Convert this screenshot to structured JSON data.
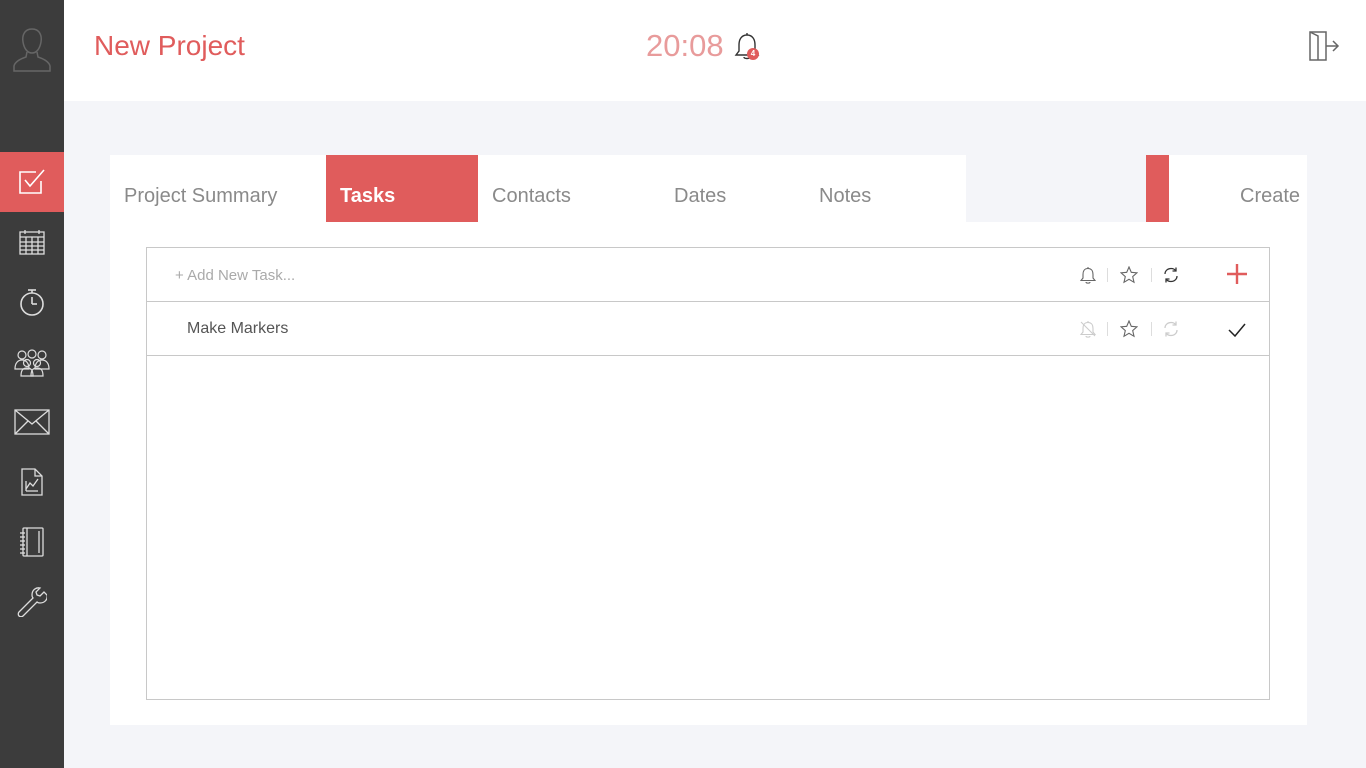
{
  "header": {
    "title": "New Project",
    "clock": "20:08",
    "notification_count": "4"
  },
  "sidebar": {
    "items": [
      {
        "icon": "checkbox-icon",
        "active": true
      },
      {
        "icon": "calendar-icon",
        "active": false
      },
      {
        "icon": "stopwatch-icon",
        "active": false
      },
      {
        "icon": "people-icon",
        "active": false
      },
      {
        "icon": "envelope-icon",
        "active": false
      },
      {
        "icon": "report-icon",
        "active": false
      },
      {
        "icon": "notebook-icon",
        "active": false
      },
      {
        "icon": "wrench-icon",
        "active": false
      }
    ]
  },
  "tabs": [
    {
      "label": "Project Summary",
      "active": false
    },
    {
      "label": "Tasks",
      "active": true
    },
    {
      "label": "Contacts",
      "active": false
    },
    {
      "label": "Dates",
      "active": false
    },
    {
      "label": "Notes",
      "active": false
    },
    {
      "label": "Create",
      "active": false
    }
  ],
  "tasks": {
    "new_placeholder": "+ Add New Task...",
    "items": [
      {
        "label": "Make Markers"
      }
    ]
  },
  "colors": {
    "accent": "#e05c5c",
    "sidebar": "#3c3c3c",
    "background": "#f4f5f9"
  }
}
